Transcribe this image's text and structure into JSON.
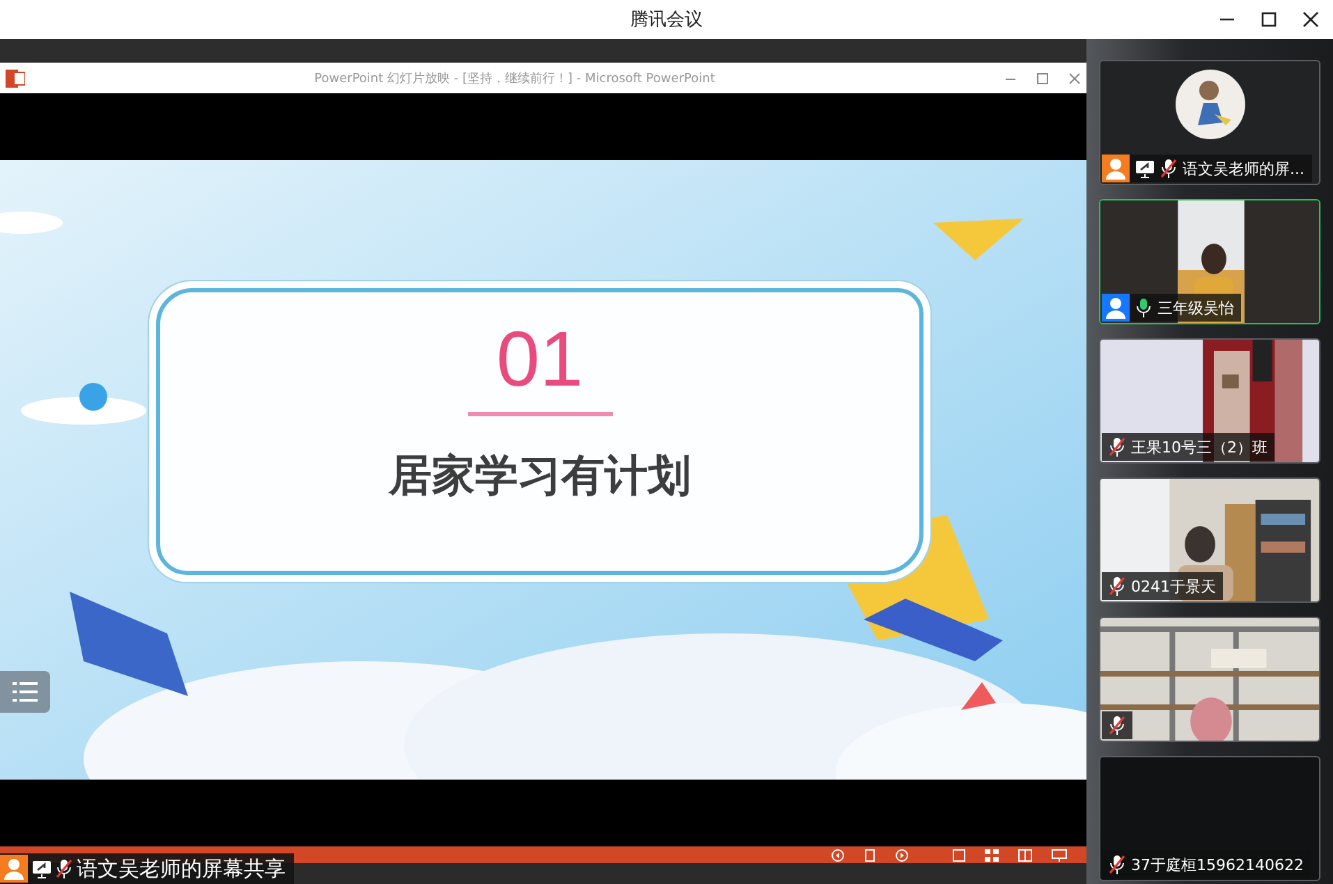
{
  "app_title": "腾讯会议",
  "shared_screen": {
    "window_title": "PowerPoint 幻灯片放映 - [坚持，继续前行！] - Microsoft PowerPoint",
    "slide": {
      "number": "01",
      "title": "居家学习有计划"
    }
  },
  "sharer": {
    "label": "语文吴老师的屏幕共享",
    "sharing": true,
    "muted": true,
    "color": "#f57c1f"
  },
  "participants": [
    {
      "kind": "avatar",
      "name": "语文吴老师的屏...",
      "color": "#f57c1f",
      "sharing": true,
      "muted": true,
      "speaking": false
    },
    {
      "kind": "video",
      "name": "三年级吴怡",
      "color": "#1677ff",
      "sharing": false,
      "muted": false,
      "speaking": true
    },
    {
      "kind": "video",
      "name": "王果10号三（2）班",
      "sharing": false,
      "muted": true,
      "speaking": false
    },
    {
      "kind": "video",
      "name": "0241于景天",
      "sharing": false,
      "muted": true,
      "speaking": false
    },
    {
      "kind": "video",
      "sharing": false,
      "muted": true,
      "speaking": false
    },
    {
      "kind": "camera_off",
      "name": "37于庭桓15962140622",
      "sharing": false,
      "muted": true,
      "speaking": false
    }
  ]
}
